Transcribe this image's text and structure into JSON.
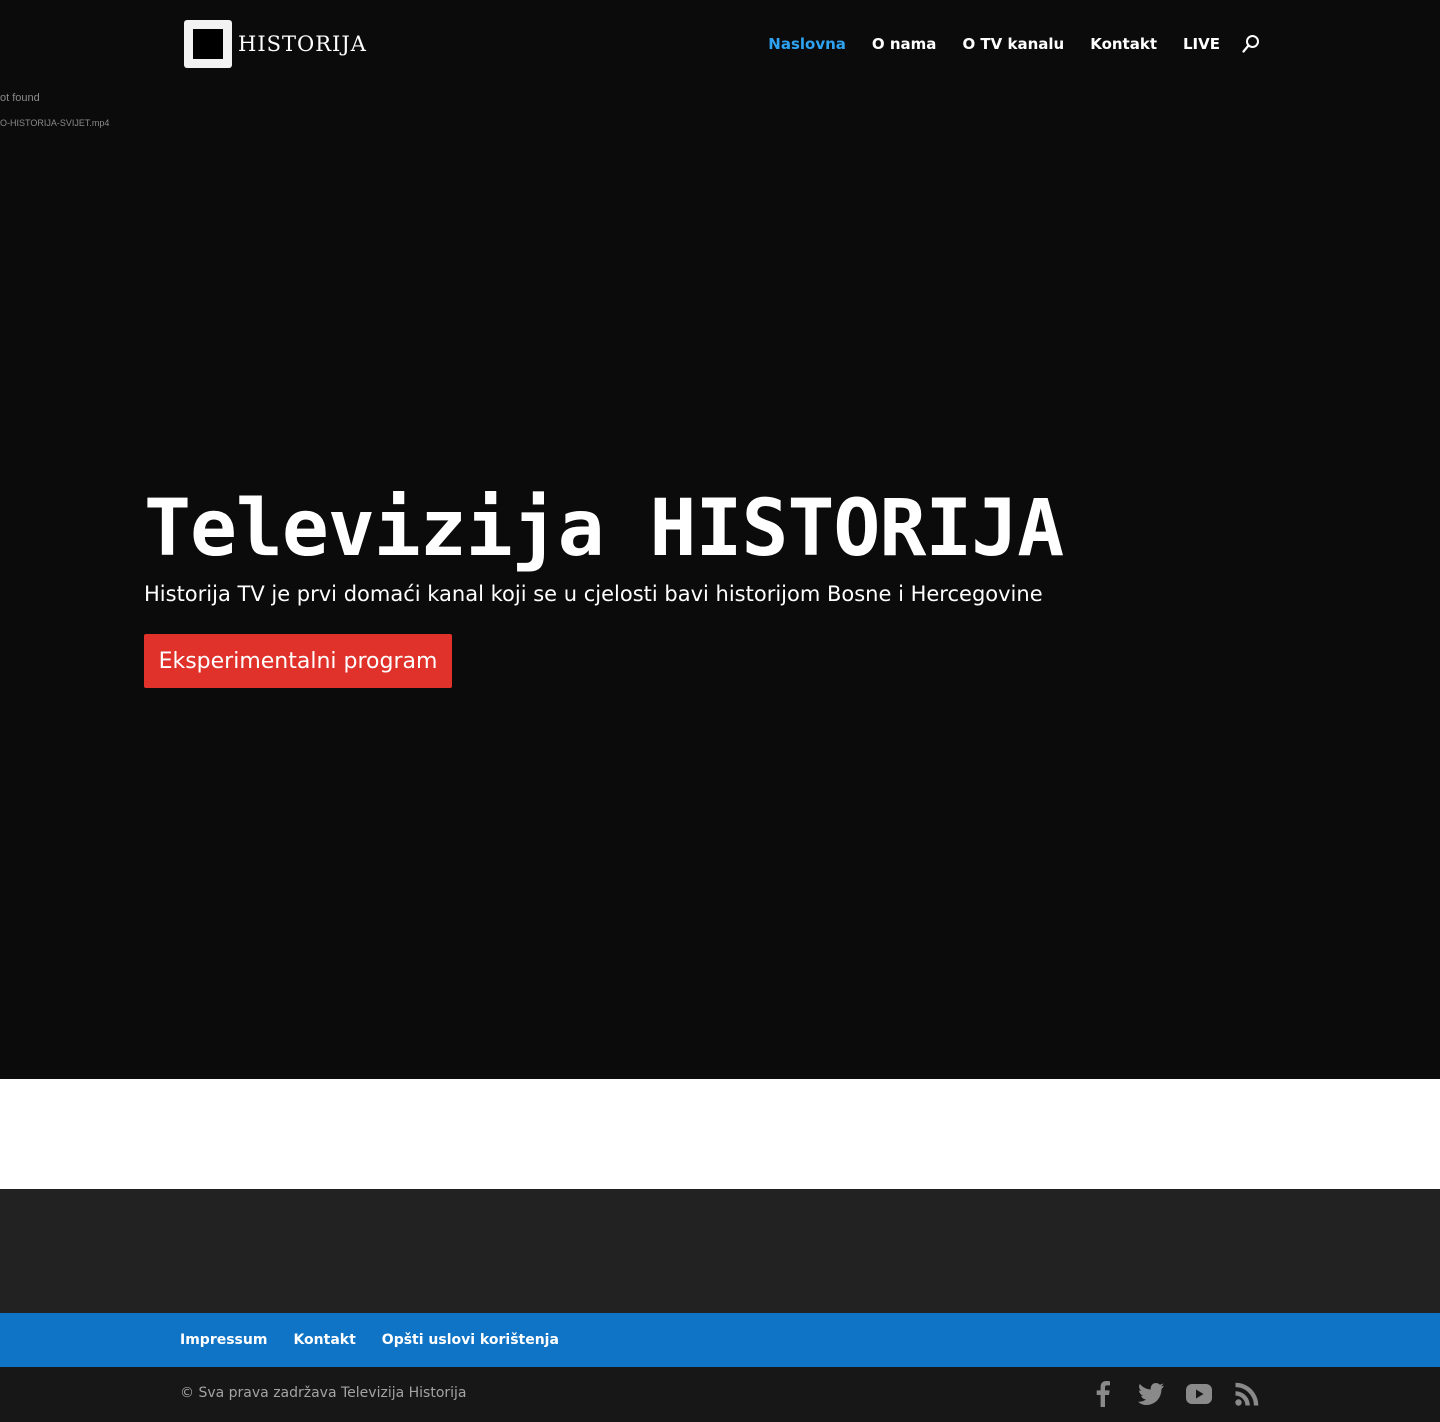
{
  "header": {
    "logo_text": "HISTORIJA",
    "nav": [
      {
        "label": "Naslovna",
        "active": true
      },
      {
        "label": "O nama",
        "active": false
      },
      {
        "label": "O TV kanalu",
        "active": false
      },
      {
        "label": "Kontakt",
        "active": false
      },
      {
        "label": "LIVE",
        "active": false
      }
    ],
    "search_icon": "search-icon"
  },
  "hero": {
    "video_error": "ot found",
    "video_file": "O-HISTORIJA-SVIJET.mp4",
    "title": "Televizija HISTORIJA",
    "subtitle": "Historija TV je prvi domaći kanal koji se u cjelosti bavi historijom Bosne i Hercegovine",
    "button_label": "Eksperimentalni program"
  },
  "footer": {
    "links": [
      "Impressum",
      "Kontakt",
      "Opšti uslovi korištenja"
    ],
    "copyright": "© Sva prava zadržava Televizija Historija",
    "social_icons": [
      "facebook-icon",
      "twitter-icon",
      "youtube-icon",
      "rss-icon"
    ]
  },
  "colors": {
    "header_bg": "#0b0b0c",
    "nav_active": "#2ea3f2",
    "button_bg": "#e0312a",
    "footer_nav_bg": "#0f73c6",
    "footer_widgets_bg": "#222222",
    "bottom_bar_bg": "#171717",
    "social_icon": "#8a8a8a"
  }
}
